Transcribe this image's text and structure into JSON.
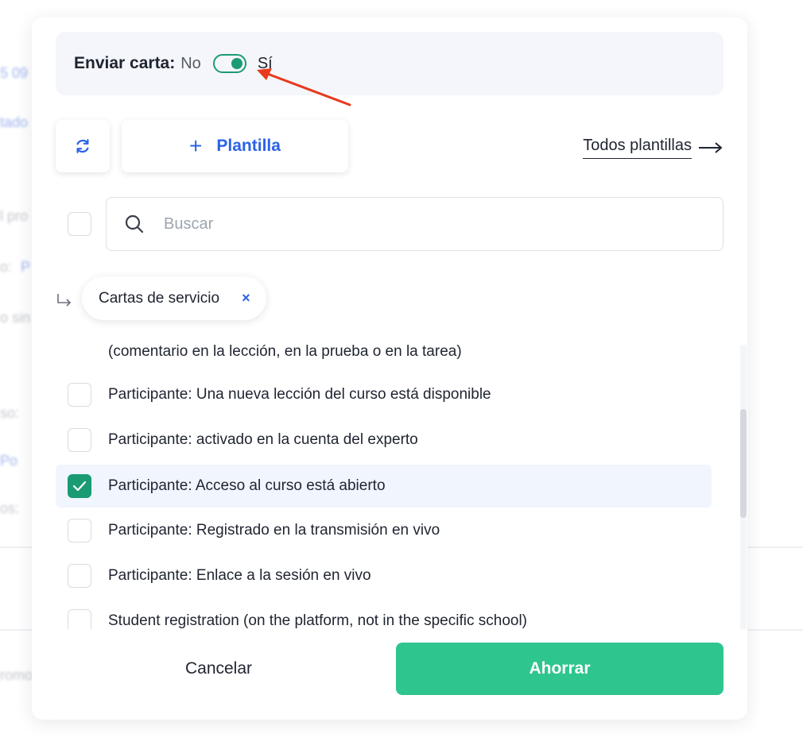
{
  "background": {
    "fragments": [
      "5 09",
      "tado",
      "l pro",
      "o:",
      "P",
      "o sin",
      "so:",
      "Po",
      "os:",
      "romo"
    ]
  },
  "modal": {
    "send_letter": {
      "label": "Enviar carta:",
      "off": "No",
      "on": "Sí",
      "enabled": true
    },
    "toolbar": {
      "refresh_icon": "refresh-icon",
      "add_template_plus": "+",
      "add_template": "Plantilla",
      "all_templates": "Todos plantillas"
    },
    "search": {
      "placeholder": "Buscar",
      "icon": "search-icon"
    },
    "filter_chip": {
      "label": "Cartas de servicio",
      "close": "×"
    },
    "list": {
      "continuation": "(comentario en la lección, en la prueba o en la tarea)",
      "items": [
        {
          "label": "Participante: Una nueva lección del curso está disponible",
          "checked": false
        },
        {
          "label": "Participante: activado en la cuenta del experto",
          "checked": false
        },
        {
          "label": "Participante: Acceso al curso está abierto",
          "checked": true
        },
        {
          "label": "Participante: Registrado en la transmisión en vivo",
          "checked": false
        },
        {
          "label": "Participante: Enlace a la sesión en vivo",
          "checked": false
        },
        {
          "label": "Student registration (on the platform, not in the specific school)",
          "checked": false
        }
      ]
    },
    "footer": {
      "cancel": "Cancelar",
      "save": "Ahorrar"
    }
  },
  "colors": {
    "accent_blue": "#2b63e6",
    "green": "#1a9b73",
    "save_green": "#2ec58e",
    "annotation_red": "#e8391d"
  }
}
